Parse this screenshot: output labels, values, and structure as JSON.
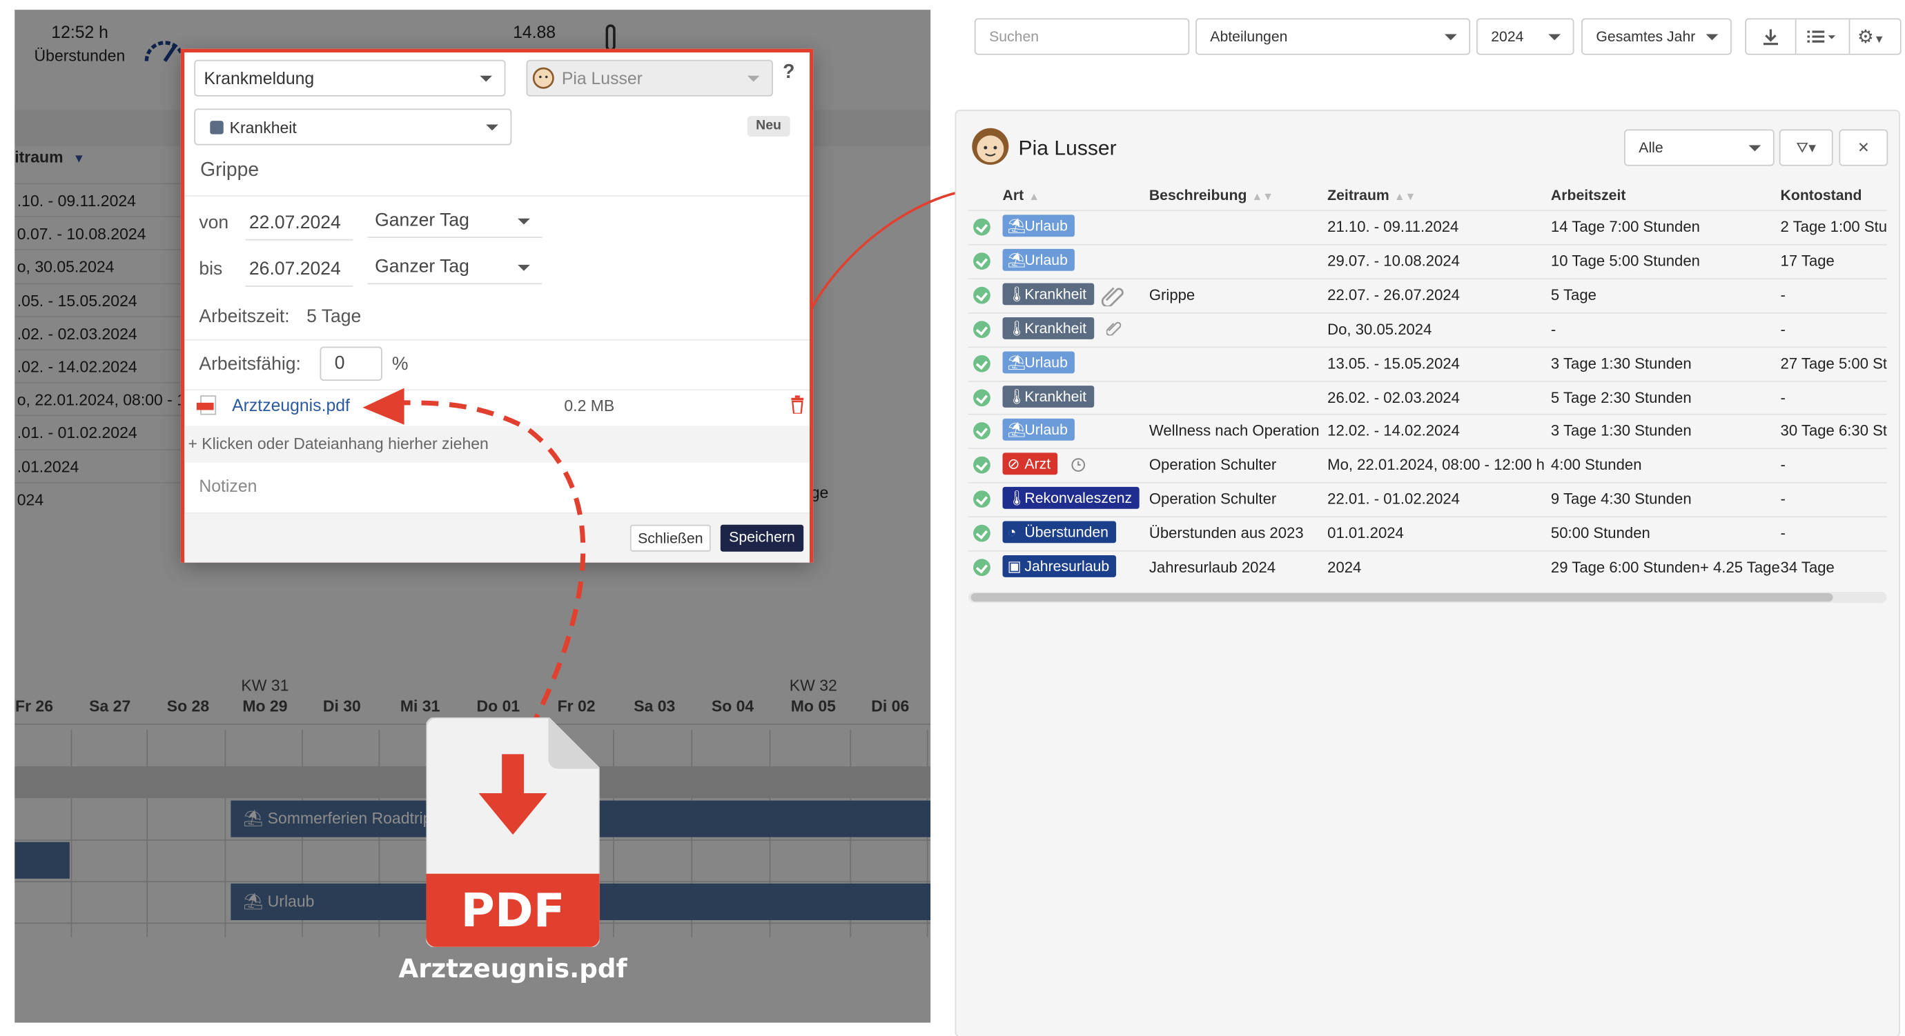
{
  "left_app": {
    "overtime_value": "12:52 h",
    "overtime_label": "Überstunden",
    "second_value": "14.88",
    "zeitraum_header": "itraum",
    "zeitraum_rows": [
      ".10. - 09.11.2024",
      "0.07. - 10.08.2024",
      "o, 30.05.2024",
      ".05. - 15.05.2024",
      ".02. - 02.03.2024",
      ".02. - 14.02.2024",
      "o, 22.01.2024, 08:00 - 1",
      ".01. - 01.02.2024",
      ".01.2024",
      "024"
    ],
    "partial_label": "ge",
    "calendar": {
      "kw": [
        "KW 31",
        "KW 32"
      ],
      "days": [
        "Fr 26",
        "Sa 27",
        "So 28",
        "Mo 29",
        "Di 30",
        "Mi 31",
        "Do 01",
        "Fr 02",
        "Sa 03",
        "So 04",
        "Mo 05",
        "Di 06"
      ],
      "bars": [
        "Sommerferien Roadtrip",
        "Urlaub"
      ]
    }
  },
  "dialog": {
    "type_value": "Krankmeldung",
    "person_value": "Pia Lusser",
    "help": "?",
    "category_value": "Krankheit",
    "new_badge": "Neu",
    "description": "Grippe",
    "from_label": "von",
    "from_date": "22.07.2024",
    "from_period": "Ganzer Tag",
    "to_label": "bis",
    "to_date": "26.07.2024",
    "to_period": "Ganzer Tag",
    "worktime_label": "Arbeitszeit:",
    "worktime_value": "5 Tage",
    "fit_label": "Arbeitsfähig:",
    "fit_value": "0",
    "fit_unit": "%",
    "attachment_name": "Arztzeugnis.pdf",
    "attachment_size": "0.2 MB",
    "dropzone": "+ Klicken oder Dateianhang hierher ziehen",
    "notes_placeholder": "Notizen",
    "close_button": "Schließen",
    "save_button": "Speichern"
  },
  "pdf_file": {
    "icon_text": "PDF",
    "filename": "Arztzeugnis.pdf"
  },
  "toolbar": {
    "search_placeholder": "Suchen",
    "department": "Abteilungen",
    "year": "2024",
    "period": "Gesamtes Jahr"
  },
  "panel": {
    "person_name": "Pia Lusser",
    "filter_value": "Alle",
    "columns": [
      "Art",
      "Beschreibung",
      "Zeitraum",
      "Arbeitszeit",
      "Kontostand"
    ],
    "rows": [
      {
        "type": "Urlaub",
        "color": "#6b9bd8",
        "icon": "beach-chair-icon",
        "description": "",
        "period": "21.10. - 09.11.2024",
        "worktime": "14 Tage 7:00 Stunden",
        "balance": "2 Tage 1:00 Stun"
      },
      {
        "type": "Urlaub",
        "color": "#6b9bd8",
        "icon": "beach-chair-icon",
        "description": "",
        "period": "29.07. - 10.08.2024",
        "worktime": "10 Tage 5:00 Stunden",
        "balance": "17 Tage"
      },
      {
        "type": "Krankheit",
        "color": "#5a6b82",
        "icon": "thermometer-icon",
        "description": "Grippe",
        "period": "22.07. - 26.07.2024",
        "worktime": "5 Tage",
        "balance": "-"
      },
      {
        "type": "Krankheit",
        "color": "#5a6b82",
        "icon": "thermometer-icon",
        "description": "",
        "period": "Do, 30.05.2024",
        "worktime": "-",
        "balance": "-"
      },
      {
        "type": "Urlaub",
        "color": "#6b9bd8",
        "icon": "beach-chair-icon",
        "description": "",
        "period": "13.05. - 15.05.2024",
        "worktime": "3 Tage 1:30 Stunden",
        "balance": "27 Tage 5:00 Stu"
      },
      {
        "type": "Krankheit",
        "color": "#5a6b82",
        "icon": "thermometer-icon",
        "description": "",
        "period": "26.02. - 02.03.2024",
        "worktime": "5 Tage 2:30 Stunden",
        "balance": "-"
      },
      {
        "type": "Urlaub",
        "color": "#6b9bd8",
        "icon": "beach-chair-icon",
        "description": "Wellness nach Operation",
        "period": "12.02. - 14.02.2024",
        "worktime": "3 Tage 1:30 Stunden",
        "balance": "30 Tage 6:30 Stu"
      },
      {
        "type": "Arzt",
        "color": "#d9342b",
        "icon": "no-entry-icon",
        "description": "Operation Schulter",
        "period": "Mo, 22.01.2024, 08:00 - 12:00 h",
        "worktime": "4:00 Stunden",
        "balance": "-"
      },
      {
        "type": "Rekonvaleszenz",
        "color": "#1f2d8f",
        "icon": "thermometer-icon",
        "description": "Operation Schulter",
        "period": "22.01. - 01.02.2024",
        "worktime": "9 Tage 4:30 Stunden",
        "balance": "-"
      },
      {
        "type": "Überstunden",
        "color": "#1c3f8c",
        "icon": "gauge-icon",
        "description": "Überstunden aus 2023",
        "period": "01.01.2024",
        "worktime": "50:00 Stunden",
        "balance": "-"
      },
      {
        "type": "Jahresurlaub",
        "color": "#1c3f8c",
        "icon": "suitcase-icon",
        "description": "Jahresurlaub 2024",
        "period": "2024",
        "worktime": "29 Tage 6:00 Stunden+ 4.25 Tage",
        "balance": "34 Tage"
      }
    ]
  },
  "colors": {
    "accent_red": "#e2402f",
    "save_button": "#1c2548",
    "link": "#2a5aa0"
  }
}
